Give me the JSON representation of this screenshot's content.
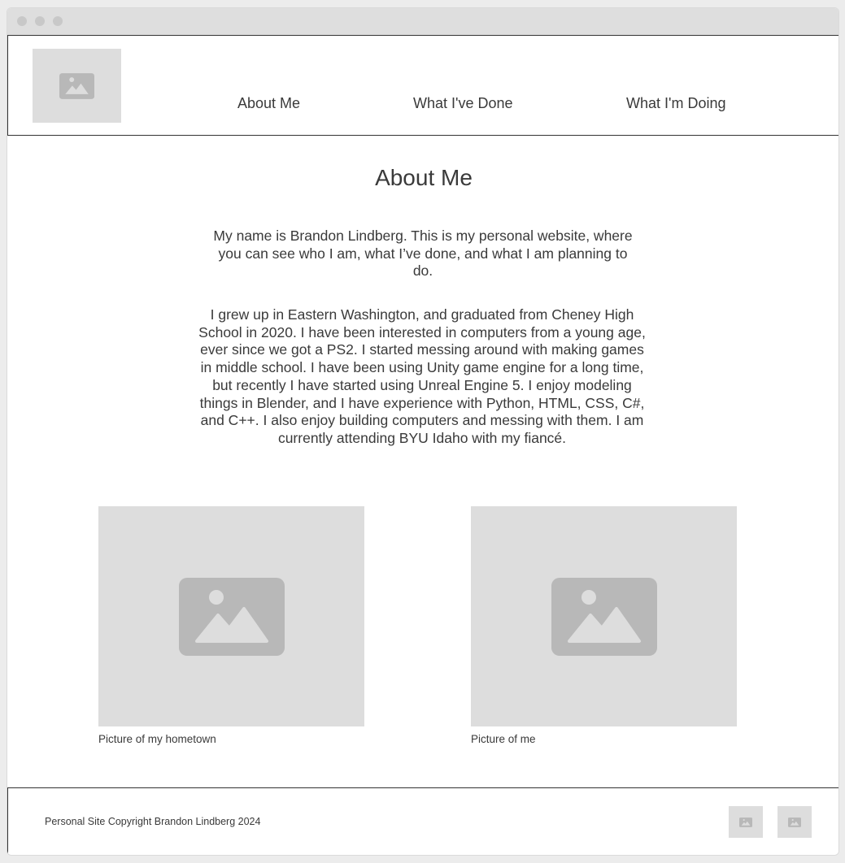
{
  "header": {
    "logo_icon": "image-placeholder-icon",
    "nav": [
      {
        "label": "About Me"
      },
      {
        "label": "What I've Done"
      },
      {
        "label": "What I'm Doing"
      }
    ]
  },
  "main": {
    "title": "About Me",
    "paragraph1": "My name is Brandon Lindberg. This is my personal website, where you can see who I am, what I’ve done, and what I am planning to do.",
    "paragraph2": "I grew up in Eastern Washington, and graduated from Cheney High School in 2020. I have been interested in computers from a young age, ever since we got a PS2. I started messing around with making games in middle school. I have been using Unity game engine for a long time, but recently I have started using Unreal Engine 5. I enjoy modeling things in Blender, and I have experience with Python, HTML, CSS, C#, and C++. I also enjoy building computers and messing with them. I am currently attending BYU Idaho with my fiancé.",
    "photos": [
      {
        "caption": "Picture of my hometown",
        "icon": "image-placeholder-icon"
      },
      {
        "caption": "Picture of me",
        "icon": "image-placeholder-icon"
      }
    ]
  },
  "footer": {
    "copyright": "Personal Site Copyright Brandon Lindberg 2024",
    "social_icons": [
      "image-placeholder-icon",
      "image-placeholder-icon"
    ]
  },
  "colors": {
    "placeholder_bg": "#dddddd",
    "placeholder_icon": "#b8b8b8",
    "text": "#3a3a3a",
    "border": "#333333"
  }
}
